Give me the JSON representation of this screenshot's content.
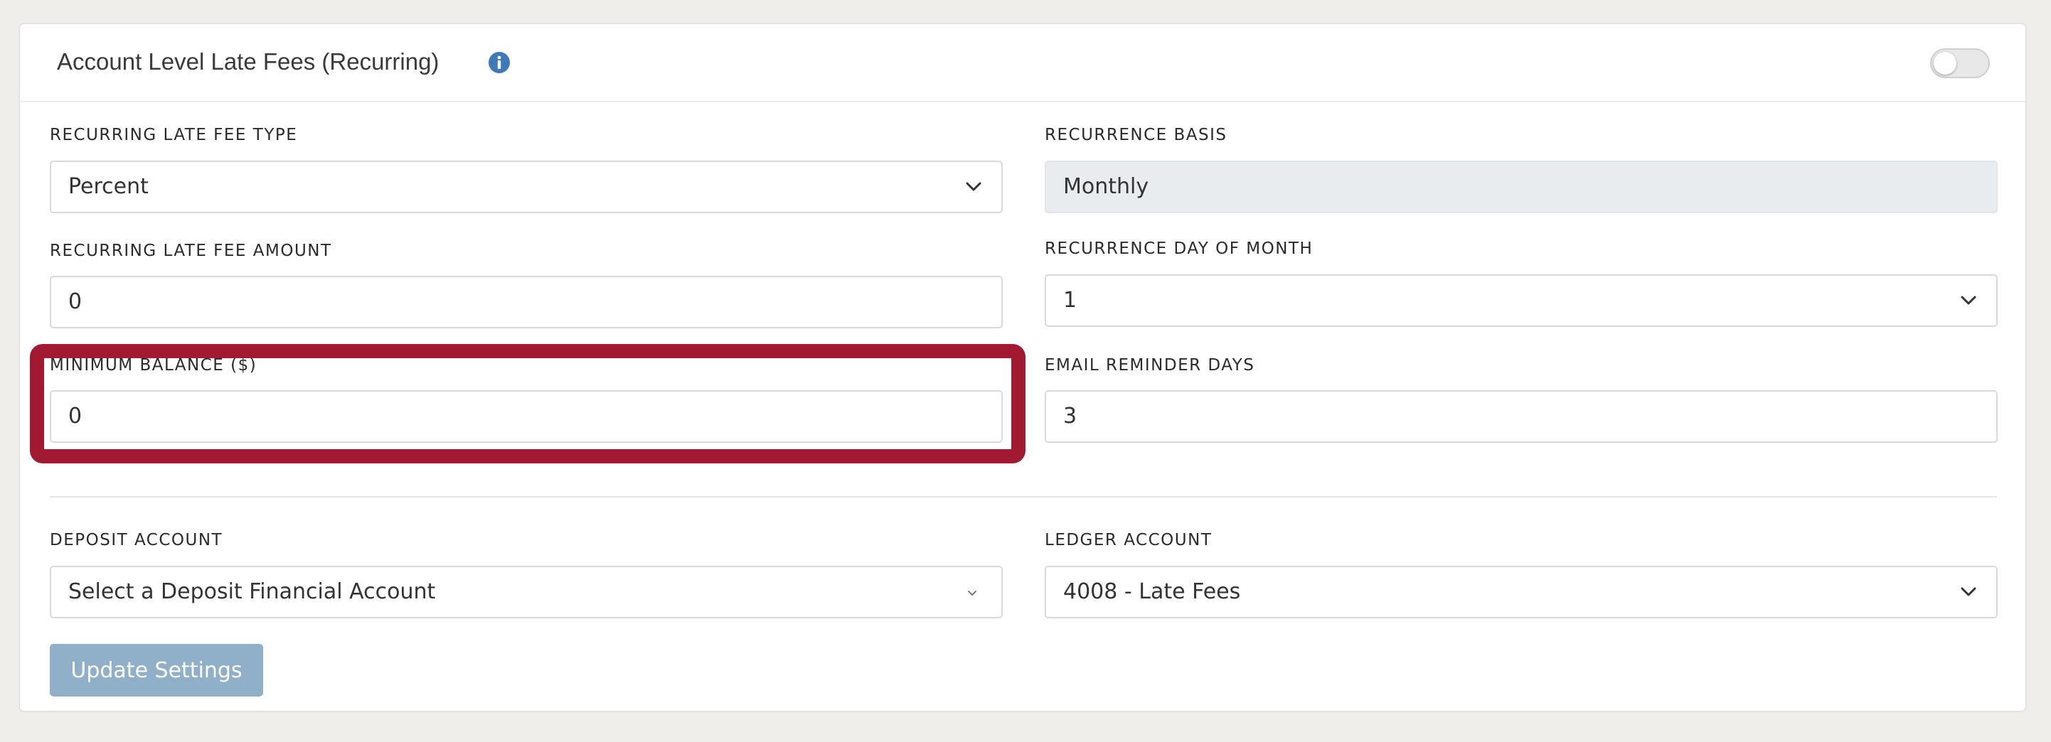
{
  "card": {
    "title": "Account Level Late Fees (Recurring)",
    "info_icon": "info-circle-icon",
    "toggle_state": "off"
  },
  "fields": {
    "recurring_late_fee_type": {
      "label": "RECURRING LATE FEE TYPE",
      "value": "Percent"
    },
    "recurrence_basis": {
      "label": "RECURRENCE BASIS",
      "value": "Monthly"
    },
    "recurring_late_fee_amount": {
      "label": "RECURRING LATE FEE AMOUNT",
      "value": "0"
    },
    "recurrence_day_of_month": {
      "label": "RECURRENCE DAY OF MONTH",
      "value": "1"
    },
    "minimum_balance": {
      "label": "MINIMUM BALANCE ($)",
      "value": "0"
    },
    "email_reminder_days": {
      "label": "EMAIL REMINDER DAYS",
      "value": "3"
    },
    "deposit_account": {
      "label": "DEPOSIT ACCOUNT",
      "value": "Select a Deposit Financial Account"
    },
    "ledger_account": {
      "label": "LEDGER ACCOUNT",
      "value": "4008 - Late Fees"
    }
  },
  "actions": {
    "update_label": "Update Settings"
  },
  "colors": {
    "highlight": "#a11a32",
    "button": "#8fb0c8",
    "info_icon": "#3d7ab8"
  }
}
